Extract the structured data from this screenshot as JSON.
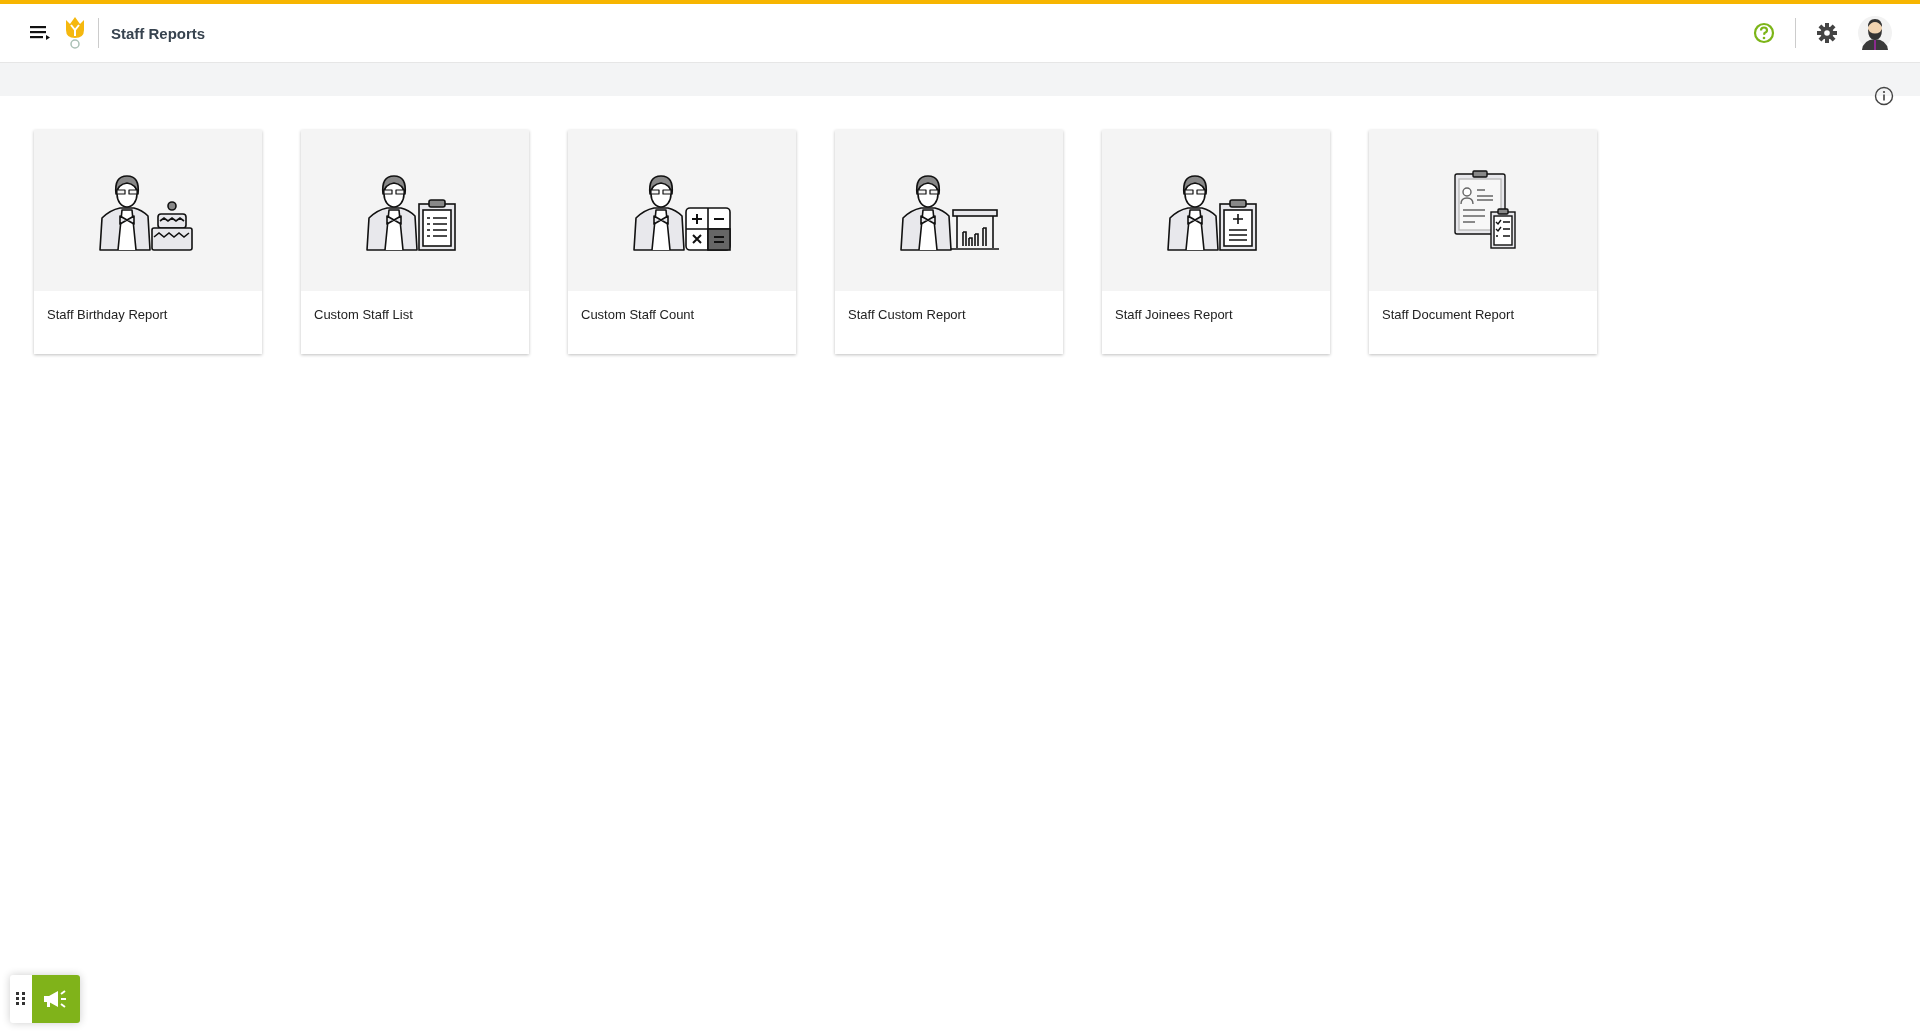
{
  "header": {
    "title": "Staff Reports"
  },
  "reports": [
    {
      "title": "Staff Birthday Report",
      "kind": "cake"
    },
    {
      "title": "Custom Staff List",
      "kind": "list"
    },
    {
      "title": "Custom Staff Count",
      "kind": "calculator"
    },
    {
      "title": "Staff Custom Report",
      "kind": "chart"
    },
    {
      "title": "Staff Joinees Report",
      "kind": "add"
    },
    {
      "title": "Staff Document Report",
      "kind": "document"
    }
  ]
}
